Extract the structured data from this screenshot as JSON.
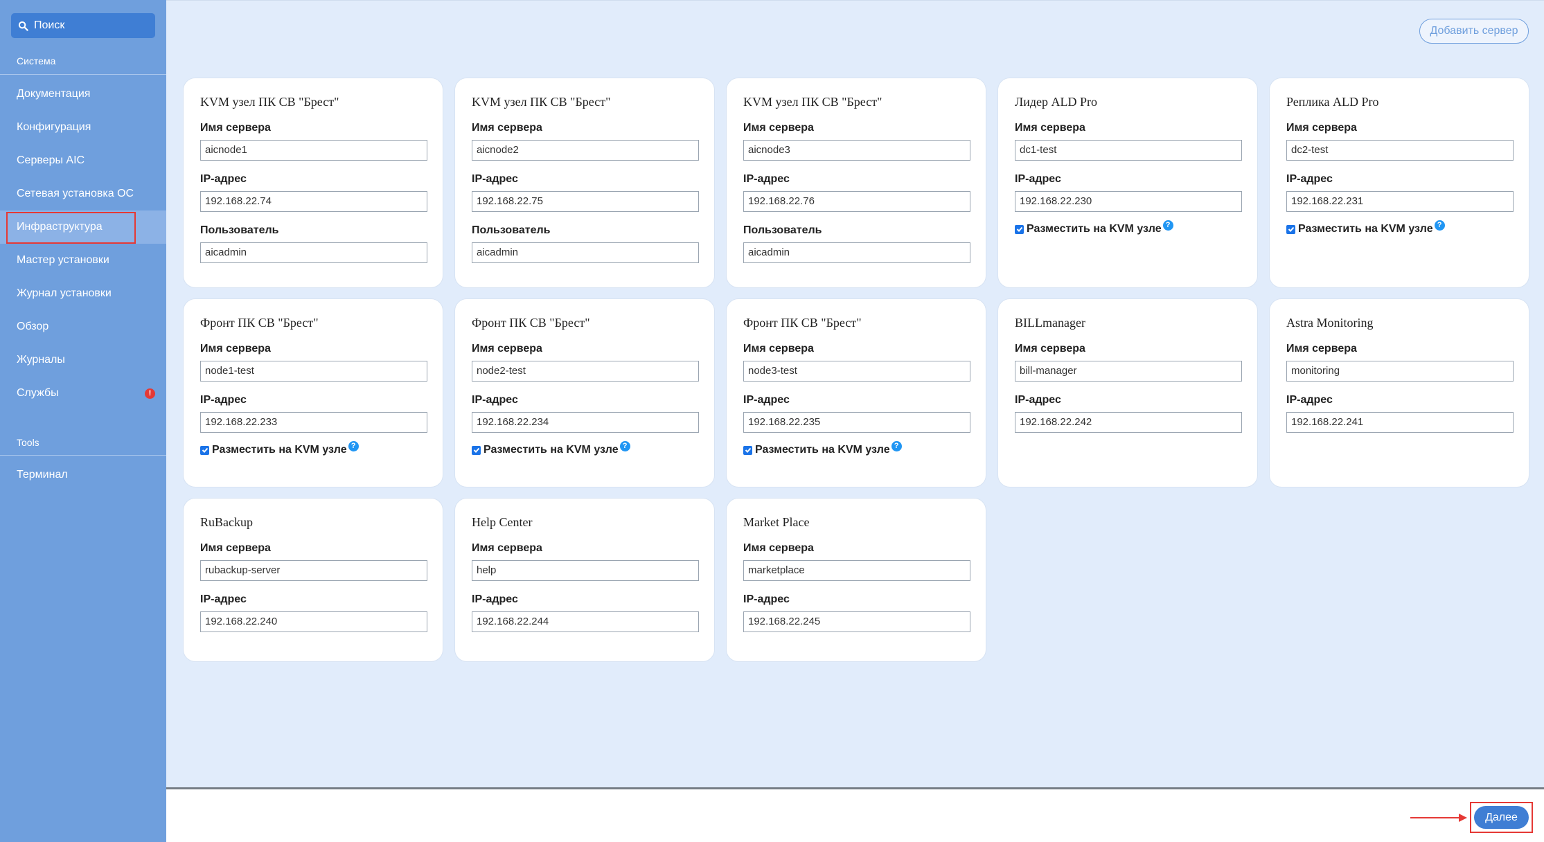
{
  "sidebar": {
    "search_label": "Поиск",
    "section_system": "Система",
    "items": [
      {
        "label": "Документация"
      },
      {
        "label": "Конфигурация"
      },
      {
        "label": "Серверы AIC"
      },
      {
        "label": "Сетевая установка ОС"
      },
      {
        "label": "Инфраструктура",
        "active": true
      },
      {
        "label": "Мастер установки"
      },
      {
        "label": "Журнал установки"
      },
      {
        "label": "Обзор"
      },
      {
        "label": "Журналы"
      },
      {
        "label": "Службы",
        "badge": "!"
      }
    ],
    "section_tools": "Tools",
    "tools_items": [
      {
        "label": "Терминал"
      }
    ]
  },
  "header": {
    "add_server_label": "Добавить сервер"
  },
  "labels": {
    "server_name": "Имя сервера",
    "ip_address": "IP-адрес",
    "user": "Пользователь",
    "place_on_kvm": "Разместить на KVM узле",
    "help": "?"
  },
  "cards": [
    {
      "title": "KVM узел ПК СВ \"Брест\"",
      "server_name": "aicnode1",
      "ip": "192.168.22.74",
      "user": "aicadmin"
    },
    {
      "title": "KVM узел ПК СВ \"Брест\"",
      "server_name": "aicnode2",
      "ip": "192.168.22.75",
      "user": "aicadmin"
    },
    {
      "title": "KVM узел ПК СВ \"Брест\"",
      "server_name": "aicnode3",
      "ip": "192.168.22.76",
      "user": "aicadmin"
    },
    {
      "title": "Лидер ALD Pro",
      "server_name": "dc1-test",
      "ip": "192.168.22.230",
      "kvm": true
    },
    {
      "title": "Реплика ALD Pro",
      "server_name": "dc2-test",
      "ip": "192.168.22.231",
      "kvm": true
    },
    {
      "title": "Фронт ПК СВ \"Брест\"",
      "server_name": "node1-test",
      "ip": "192.168.22.233",
      "kvm": true
    },
    {
      "title": "Фронт ПК СВ \"Брест\"",
      "server_name": "node2-test",
      "ip": "192.168.22.234",
      "kvm": true
    },
    {
      "title": "Фронт ПК СВ \"Брест\"",
      "server_name": "node3-test",
      "ip": "192.168.22.235",
      "kvm": true
    },
    {
      "title": "BILLmanager",
      "server_name": "bill-manager",
      "ip": "192.168.22.242"
    },
    {
      "title": "Astra Monitoring",
      "server_name": "monitoring",
      "ip": "192.168.22.241"
    },
    {
      "title": "RuBackup",
      "server_name": "rubackup-server",
      "ip": "192.168.22.240"
    },
    {
      "title": "Help Center",
      "server_name": "help",
      "ip": "192.168.22.244"
    },
    {
      "title": "Market Place",
      "server_name": "marketplace",
      "ip": "192.168.22.245"
    }
  ],
  "footer": {
    "next_label": "Далее"
  },
  "colors": {
    "sidebar_bg": "#6f9fdd",
    "main_bg": "#e1ecfb",
    "accent": "#3f7ed4",
    "highlight": "#e53935"
  }
}
